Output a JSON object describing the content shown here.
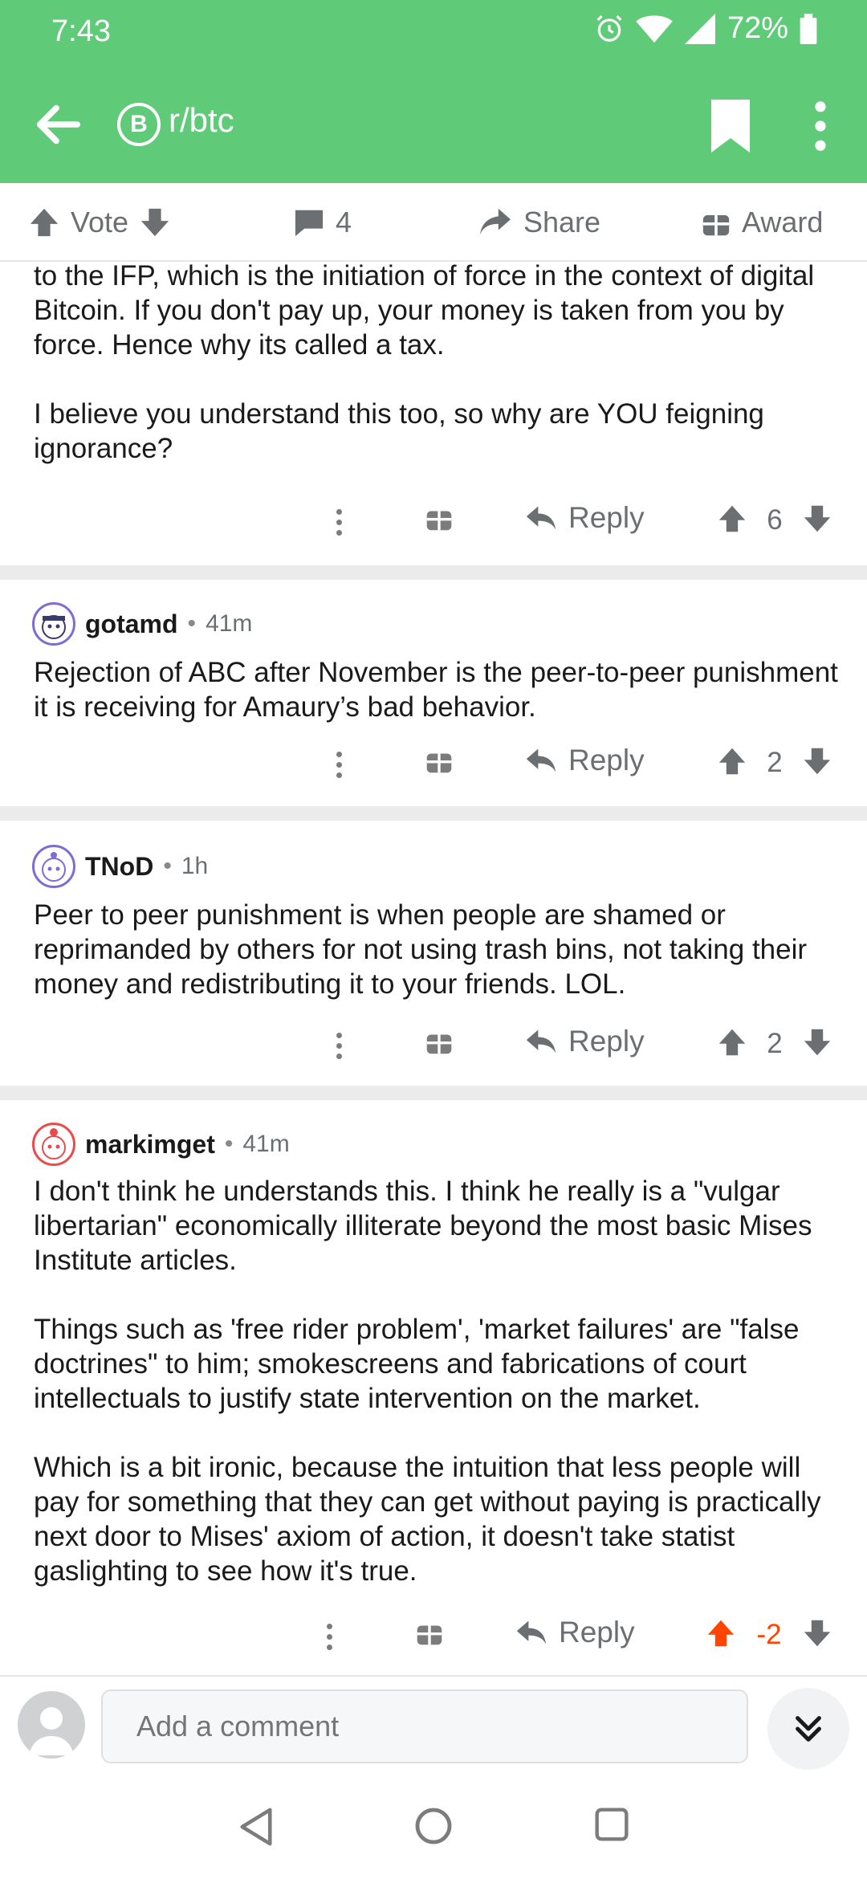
{
  "status_bar": {
    "time": "7:43",
    "battery": "72%"
  },
  "header": {
    "subreddit": "r/btc",
    "sub_icon_glyph": "B"
  },
  "action_bar": {
    "vote": "Vote",
    "comments": "4",
    "share": "Share",
    "award": "Award"
  },
  "comments": [
    {
      "author": "",
      "age": "",
      "paragraphs": [
        "to the IFP, which is the initiation of force in the context of digital Bitcoin. If you don't pay up, your money is taken from you by force. Hence why its called a tax.",
        "I believe you understand this too, so why are YOU feigning ignorance?"
      ],
      "reply": "Reply",
      "score": "6",
      "score_color": "#6b6f72"
    },
    {
      "author": "gotamd",
      "age": "41m",
      "paragraphs": [
        "Rejection of ABC after November is the peer-to-peer punishment it is receiving for Amaury’s bad behavior."
      ],
      "reply": "Reply",
      "score": "2",
      "score_color": "#6b6f72"
    },
    {
      "author": "TNoD",
      "age": "1h",
      "paragraphs": [
        "Peer to peer punishment is when people are shamed or reprimanded by others for not using trash bins, not taking their money and redistributing it to your friends. LOL."
      ],
      "reply": "Reply",
      "score": "2",
      "score_color": "#6b6f72"
    },
    {
      "author": "markimget",
      "age": "41m",
      "paragraphs": [
        "I don't think he understands this. I think he really is a \"vulgar libertarian\" economically illiterate beyond the most basic Mises Institute articles.",
        "Things such as 'free rider problem', 'market failures' are \"false doctrines\" to him; smokescreens and fabrications of court intellectuals to justify state intervention on the market.",
        "Which is a bit ironic, because the intuition that less people will pay for something that they can get without paying is practically next door to Mises' axiom of action, it doesn't take statist gaslighting to see how it's true."
      ],
      "reply": "Reply",
      "score": "-2",
      "score_color": "#ff4500"
    }
  ],
  "composer": {
    "placeholder": "Add a comment"
  },
  "colors": {
    "header_green": "#5fcb78",
    "upvote_orange": "#ff4500",
    "icon_gray": "#6b6f72"
  },
  "icons": [
    "back-arrow-icon",
    "bitcoin-icon",
    "bookmark-icon",
    "more-vertical-icon",
    "upvote-icon",
    "downvote-icon",
    "comment-icon",
    "share-icon",
    "gift-icon",
    "reply-icon",
    "chevron-double-down-icon",
    "nav-back-icon",
    "nav-home-icon",
    "nav-recents-icon"
  ]
}
